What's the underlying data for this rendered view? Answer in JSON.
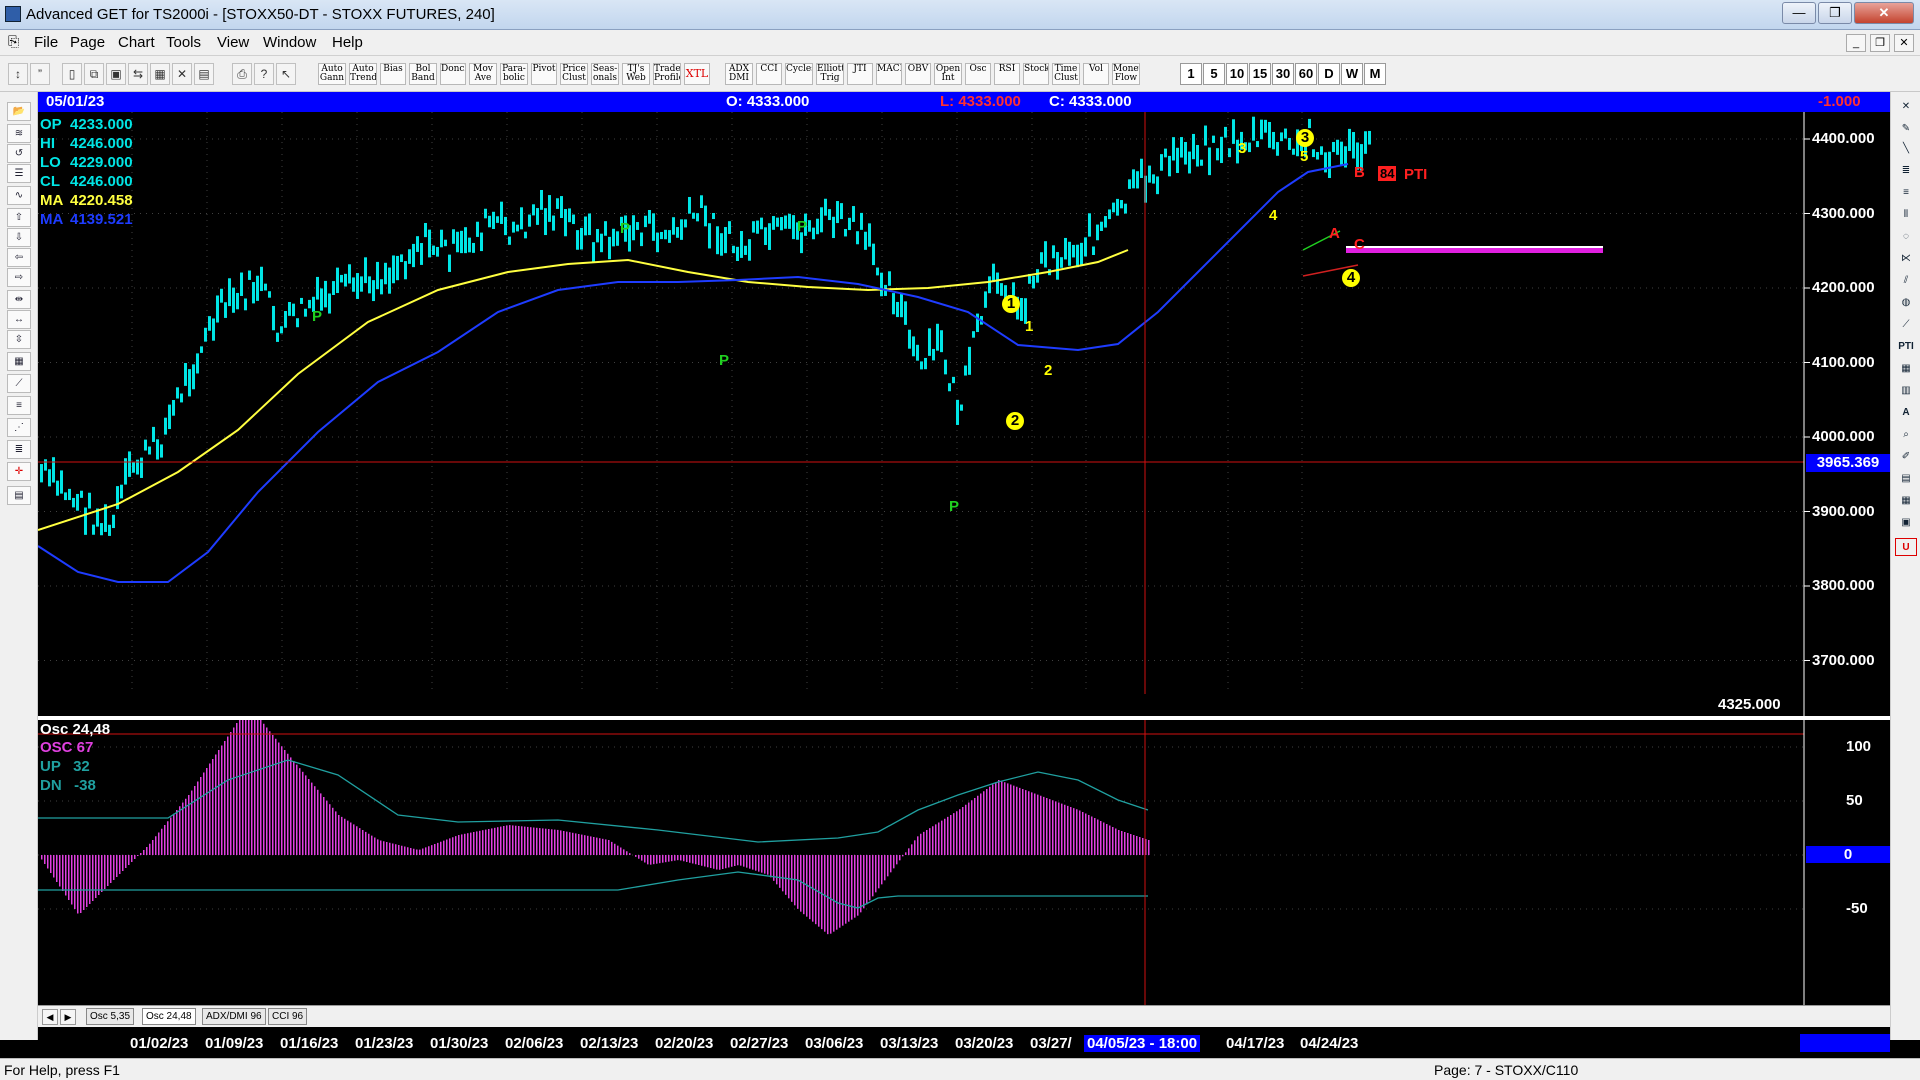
{
  "window": {
    "title": "Advanced GET for TS2000i - [STOXX50-DT - STOXX FUTURES, 240]",
    "minimize": "—",
    "maximize": "❐",
    "close": "✕"
  },
  "menu": [
    "File",
    "Page",
    "Chart",
    "Tools",
    "View",
    "Window",
    "Help"
  ],
  "toolbar": {
    "studies": [
      "Auto Gann",
      "Auto Trend",
      "Bias",
      "Bol Band",
      "Donch",
      "Mov Ave",
      "Para-bolic",
      "Pivot",
      "Price Clust",
      "Seas-onals",
      "TJ's Web",
      "Trade Profile",
      "XTL",
      "ADX DMI",
      "CCI",
      "Cycles",
      "Elliott Trig",
      "JTI",
      "MACD",
      "OBV",
      "Open Int",
      "Osc",
      "RSI",
      "Stock",
      "Time Clust",
      "Vol",
      "Money Flow"
    ],
    "intervals": [
      "1",
      "5",
      "10",
      "15",
      "30",
      "60",
      "D",
      "W",
      "M"
    ]
  },
  "infobar": {
    "date": "05/01/23",
    "open": "O: 4333.000",
    "low": "L: 4333.000",
    "close": "C: 4333.000",
    "change": "-1.000"
  },
  "readout": [
    {
      "label": "OP",
      "value": "4233.000",
      "color": "#00e5e5"
    },
    {
      "label": "HI",
      "value": "4246.000",
      "color": "#00e5e5"
    },
    {
      "label": "LO",
      "value": "4229.000",
      "color": "#00e5e5"
    },
    {
      "label": "CL",
      "value": "4246.000",
      "color": "#00e5e5"
    },
    {
      "label": "MA",
      "value": "4220.458",
      "color": "#ffff40"
    },
    {
      "label": "MA",
      "value": "4139.521",
      "color": "#1e3cff"
    }
  ],
  "price_axis": [
    "4400.000",
    "4300.000",
    "4200.000",
    "4100.000",
    "4000.000",
    "3900.000",
    "3800.000",
    "3700.000"
  ],
  "cursor_price": "3965.369",
  "bottom_price": "4325.000",
  "osc_panel": {
    "title": "Osc 24,48",
    "osc": "OSC 67",
    "up": "UP   32",
    "dn": "DN   -38",
    "axis": [
      "100",
      "50",
      "0",
      "-50"
    ]
  },
  "annotations": {
    "pivot": "P",
    "wave_1": "1",
    "wave_2": "2",
    "wave_3": "3",
    "wave_4": "4",
    "wave_5": "5",
    "wave_a": "A",
    "wave_b": "B",
    "wave_c": "C",
    "pti_value": "84",
    "pti_label": "PTI"
  },
  "tabs": [
    "Osc 5,35",
    "Osc 24,48",
    "ADX/DMI 96",
    "CCI 96"
  ],
  "dates": [
    "01/02/23",
    "01/09/23",
    "01/16/23",
    "01/23/23",
    "01/30/23",
    "02/06/23",
    "02/13/23",
    "02/20/23",
    "02/27/23",
    "03/06/23",
    "03/13/23",
    "03/20/23",
    "03/27/",
    "04/05/23 - 18:00",
    "04/17/23",
    "04/24/23"
  ],
  "status": {
    "help": "For Help, press F1",
    "page": "Page: 7 - STOXX/C110"
  },
  "colors": {
    "bars": "#00e5e5",
    "ma_fast": "#ffff40",
    "ma_slow": "#1e3cff",
    "osc_hist": "#e040e0",
    "osc_line": "#20a0a0",
    "grid": "#404040",
    "cursor": "#d01010",
    "pivot": "#20d020"
  }
}
